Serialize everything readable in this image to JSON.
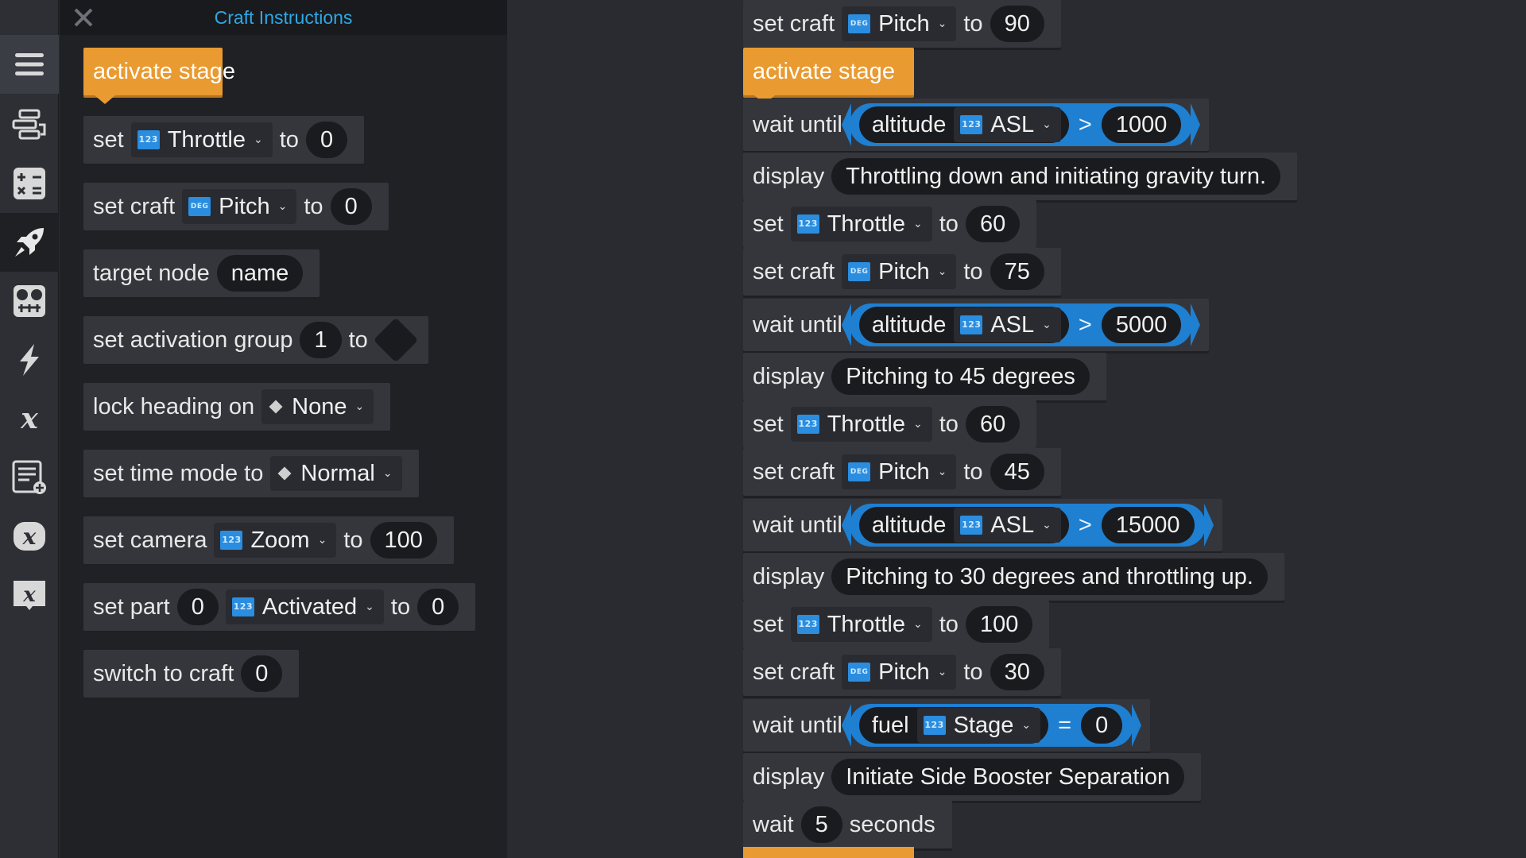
{
  "flyout": {
    "title": "Craft Instructions",
    "blocks": {
      "activate_stage": "activate stage",
      "set_throttle": {
        "kw": "set",
        "prop": "Throttle",
        "prop_type": "123",
        "to": "to",
        "value": "0"
      },
      "set_craft_pitch": {
        "kw": "set craft",
        "prop": "Pitch",
        "prop_type": "DEG",
        "to": "to",
        "value": "0"
      },
      "target_node": {
        "kw": "target node",
        "value": "name"
      },
      "set_activation_group": {
        "kw": "set activation group",
        "value": "1",
        "to": "to"
      },
      "lock_heading": {
        "kw": "lock heading on",
        "option": "None"
      },
      "set_time_mode": {
        "kw": "set time mode to",
        "option": "Normal"
      },
      "set_camera": {
        "kw": "set camera",
        "prop": "Zoom",
        "prop_type": "123",
        "to": "to",
        "value": "100"
      },
      "set_part": {
        "kw": "set part",
        "part": "0",
        "prop": "Activated",
        "prop_type": "123",
        "to": "to",
        "value": "0"
      },
      "switch_to_craft": {
        "kw": "switch to craft",
        "value": "0"
      }
    }
  },
  "script": {
    "b0": {
      "kw": "set craft",
      "prop": "Pitch",
      "prop_type": "DEG",
      "to": "to",
      "value": "90"
    },
    "b1": {
      "kw": "activate stage"
    },
    "b2": {
      "kw": "wait until",
      "lhs": "altitude",
      "prop": "ASL",
      "prop_type": "123",
      "op": ">",
      "value": "1000"
    },
    "b3": {
      "kw": "display",
      "text": "Throttling down and initiating gravity turn."
    },
    "b4": {
      "kw": "set",
      "prop": "Throttle",
      "prop_type": "123",
      "to": "to",
      "value": "60"
    },
    "b5": {
      "kw": "set craft",
      "prop": "Pitch",
      "prop_type": "DEG",
      "to": "to",
      "value": "75"
    },
    "b6": {
      "kw": "wait until",
      "lhs": "altitude",
      "prop": "ASL",
      "prop_type": "123",
      "op": ">",
      "value": "5000"
    },
    "b7": {
      "kw": "display",
      "text": "Pitching to 45 degrees"
    },
    "b8": {
      "kw": "set",
      "prop": "Throttle",
      "prop_type": "123",
      "to": "to",
      "value": "60"
    },
    "b9": {
      "kw": "set craft",
      "prop": "Pitch",
      "prop_type": "DEG",
      "to": "to",
      "value": "45"
    },
    "b10": {
      "kw": "wait until",
      "lhs": "altitude",
      "prop": "ASL",
      "prop_type": "123",
      "op": ">",
      "value": "15000"
    },
    "b11": {
      "kw": "display",
      "text": "Pitching to 30 degrees and throttling up."
    },
    "b12": {
      "kw": "set",
      "prop": "Throttle",
      "prop_type": "123",
      "to": "to",
      "value": "100"
    },
    "b13": {
      "kw": "set craft",
      "prop": "Pitch",
      "prop_type": "DEG",
      "to": "to",
      "value": "30"
    },
    "b14": {
      "kw": "wait until",
      "lhs": "fuel",
      "prop": "Stage",
      "prop_type": "123",
      "op": "=",
      "value": "0"
    },
    "b15": {
      "kw": "display",
      "text": "Initiate Side Booster Separation"
    },
    "b16": {
      "kw": "wait",
      "value": "5",
      "suffix": "seconds"
    }
  },
  "colors": {
    "event": "#e99a30",
    "condition": "#1f7fd1",
    "type_badge": "#2a8de0",
    "title": "#2ea8e6",
    "block": "#35363b"
  },
  "rail_icons": [
    "menu-icon",
    "program-flow-icon",
    "operators-icon",
    "craft-instructions-icon",
    "craft-info-icon",
    "events-icon",
    "variables-icon",
    "lists-icon",
    "custom-expressions-icon",
    "custom-instructions-icon"
  ]
}
